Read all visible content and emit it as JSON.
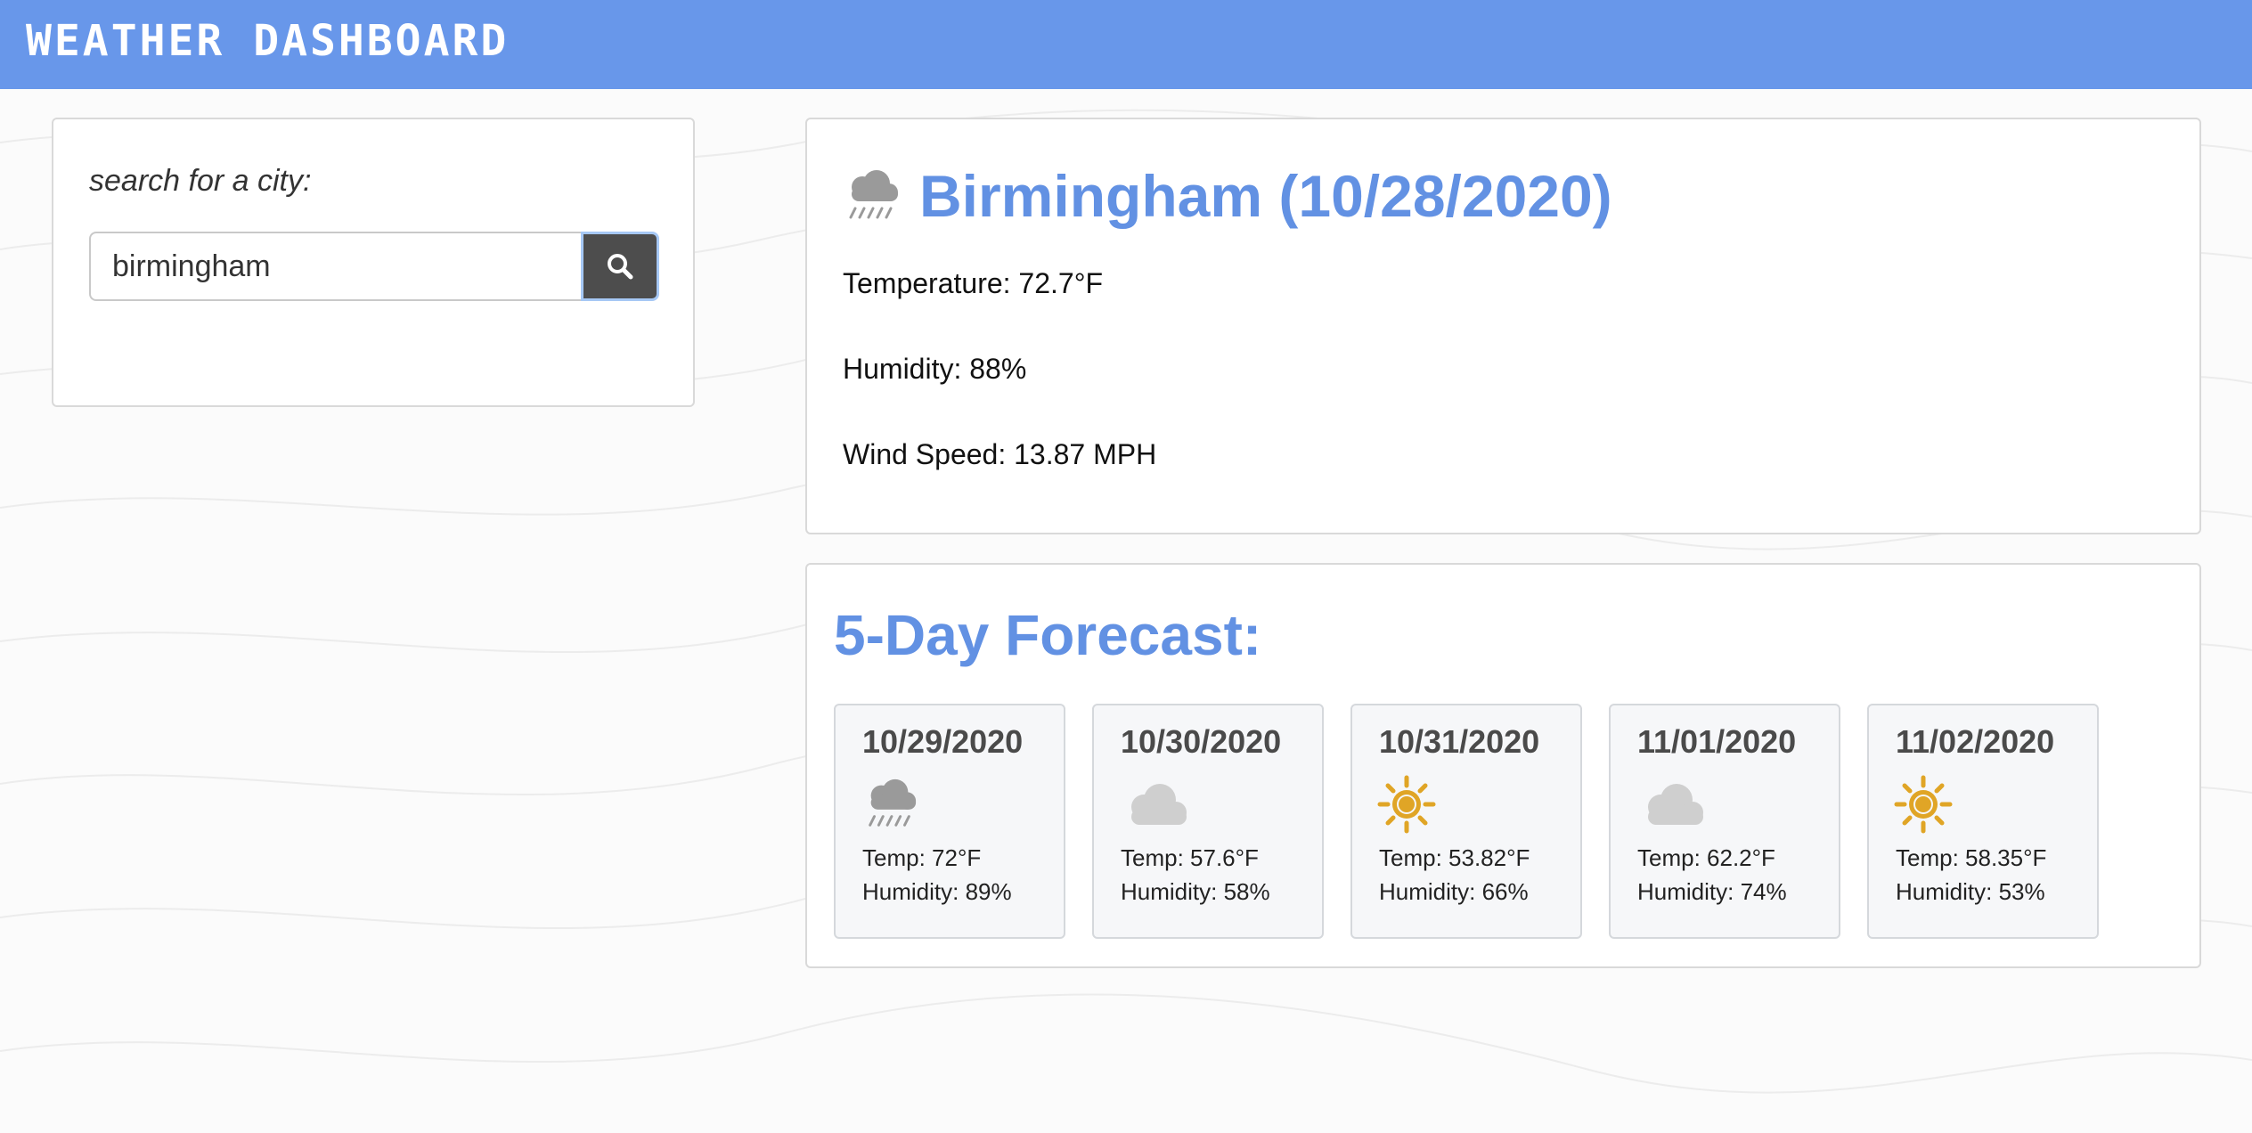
{
  "header": {
    "title": "WEATHER DASHBOARD"
  },
  "search": {
    "label": "search for a city:",
    "value": "birmingham",
    "button_icon": "search-icon"
  },
  "current": {
    "title": "Birmingham (10/28/2020)",
    "icon": "rain-icon",
    "temperature": "Temperature: 72.7°F",
    "humidity": "Humidity: 88%",
    "wind": "Wind Speed: 13.87 MPH"
  },
  "forecast": {
    "title": "5-Day Forecast:",
    "days": [
      {
        "date": "10/29/2020",
        "icon": "rain-icon",
        "temp": "Temp: 72°F",
        "humidity": "Humidity: 89%"
      },
      {
        "date": "10/30/2020",
        "icon": "cloud-icon",
        "temp": "Temp: 57.6°F",
        "humidity": "Humidity: 58%"
      },
      {
        "date": "10/31/2020",
        "icon": "sun-icon",
        "temp": "Temp: 53.82°F",
        "humidity": "Humidity: 66%"
      },
      {
        "date": "11/01/2020",
        "icon": "cloud-icon",
        "temp": "Temp: 62.2°F",
        "humidity": "Humidity: 74%"
      },
      {
        "date": "11/02/2020",
        "icon": "sun-icon",
        "temp": "Temp: 58.35°F",
        "humidity": "Humidity: 53%"
      }
    ]
  },
  "colors": {
    "header": "#6897ea",
    "accent": "#6291e3",
    "search_button": "#4d4d4d",
    "sun": "#e0a526",
    "cloud": "#cfcfcf",
    "rain_cloud": "#9a9a9a"
  }
}
